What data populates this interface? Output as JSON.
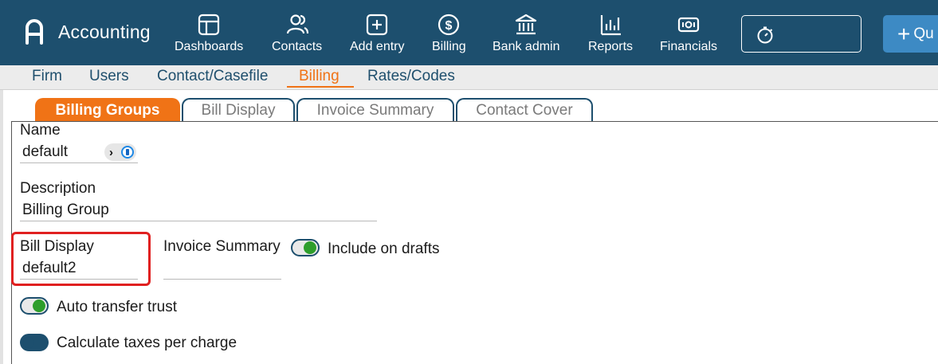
{
  "app": {
    "title": "Accounting"
  },
  "nav": {
    "items": [
      {
        "label": "Dashboards",
        "icon": "dashboard-icon"
      },
      {
        "label": "Contacts",
        "icon": "contacts-icon"
      },
      {
        "label": "Add entry",
        "icon": "add-entry-icon"
      },
      {
        "label": "Billing",
        "icon": "dollar-icon"
      },
      {
        "label": "Bank admin",
        "icon": "bank-icon"
      },
      {
        "label": "Reports",
        "icon": "bar-chart-icon"
      },
      {
        "label": "Financials",
        "icon": "money-icon"
      }
    ],
    "timer_icon": "stopwatch-icon",
    "quick_label": "Qu"
  },
  "subnav": {
    "items": [
      "Firm",
      "Users",
      "Contact/Casefile",
      "Billing",
      "Rates/Codes"
    ],
    "active": "Billing"
  },
  "tabs": {
    "items": [
      "Billing Groups",
      "Bill Display",
      "Invoice Summary",
      "Contact Cover"
    ],
    "active": "Billing Groups"
  },
  "form": {
    "name": {
      "label": "Name",
      "value": "default"
    },
    "description": {
      "label": "Description",
      "value": "Billing Group"
    },
    "bill_display": {
      "label": "Bill Display",
      "value": "default2"
    },
    "invoice_summary": {
      "label": "Invoice Summary",
      "value": ""
    },
    "include_on_drafts": {
      "label": "Include on drafts",
      "on": true
    },
    "auto_transfer_trust": {
      "label": "Auto transfer trust",
      "on": true
    },
    "calculate_taxes": {
      "label": "Calculate taxes per charge",
      "on": false
    }
  },
  "colors": {
    "nav_bg": "#1d4f6e",
    "accent": "#f07316",
    "toggle_on": "#2e9e2b",
    "highlight": "#e02020",
    "quick_button": "#3d8ac4"
  }
}
